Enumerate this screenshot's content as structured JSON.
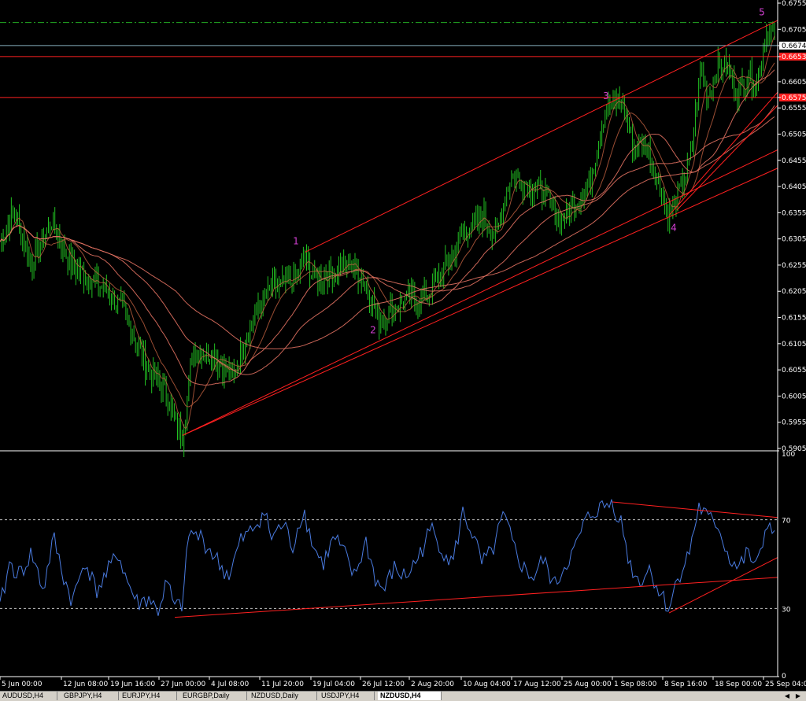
{
  "chart_data": [
    {
      "type": "candlestick",
      "symbol": "NZDUSD",
      "timeframe": "H4",
      "price_ylim": [
        0.5905,
        0.6755
      ],
      "price_ticks": [
        "0.6755",
        "0.6705",
        "0.6674",
        "0.6653",
        "0.6605",
        "0.6575",
        "0.6555",
        "0.6505",
        "0.6455",
        "0.6405",
        "0.6355",
        "0.6305",
        "0.6255",
        "0.6205",
        "0.6155",
        "0.6105",
        "0.6055",
        "0.6005",
        "0.5955",
        "0.5905"
      ],
      "current_price": "0.6674",
      "highlighted_levels": [
        "0.6653",
        "0.6575"
      ],
      "horizontal_levels": [
        {
          "price": 0.6718,
          "style": "dash-dot",
          "color": "#22aa22"
        },
        {
          "price": 0.6674,
          "style": "solid",
          "color": "#88b0c0"
        },
        {
          "price": 0.6653,
          "style": "solid",
          "color": "#ff2020"
        },
        {
          "price": 0.6575,
          "style": "solid",
          "color": "#ff2020"
        }
      ],
      "wave_labels": [
        "1",
        "2",
        "3",
        "4",
        "5"
      ],
      "x_ticks": [
        "5 Jun 00:00",
        "12 Jun 08:00",
        "19 Jun 16:00",
        "27 Jun 00:00",
        "4 Jul 08:00",
        "11 Jul 20:00",
        "19 Jul 04:00",
        "26 Jul 12:00",
        "2 Aug 20:00",
        "10 Aug 04:00",
        "17 Aug 12:00",
        "25 Aug 00:00",
        "1 Sep 08:00",
        "8 Sep 16:00",
        "18 Sep 00:00",
        "25 Sep 04:00"
      ],
      "anchor_closes": [
        [
          0,
          0.63
        ],
        [
          18,
          0.636
        ],
        [
          40,
          0.6255
        ],
        [
          65,
          0.634
        ],
        [
          90,
          0.6255
        ],
        [
          115,
          0.623
        ],
        [
          140,
          0.62
        ],
        [
          160,
          0.616
        ],
        [
          185,
          0.606
        ],
        [
          210,
          0.602
        ],
        [
          225,
          0.5945
        ],
        [
          232,
          0.593
        ],
        [
          245,
          0.6095
        ],
        [
          270,
          0.6085
        ],
        [
          295,
          0.604
        ],
        [
          320,
          0.615
        ],
        [
          345,
          0.621
        ],
        [
          370,
          0.622
        ],
        [
          388,
          0.627
        ],
        [
          400,
          0.6225
        ],
        [
          420,
          0.624
        ],
        [
          445,
          0.626
        ],
        [
          465,
          0.622
        ],
        [
          482,
          0.615
        ],
        [
          500,
          0.6175
        ],
        [
          520,
          0.619
        ],
        [
          540,
          0.6195
        ],
        [
          565,
          0.625
        ],
        [
          590,
          0.632
        ],
        [
          615,
          0.6345
        ],
        [
          630,
          0.6305
        ],
        [
          648,
          0.6425
        ],
        [
          670,
          0.641
        ],
        [
          690,
          0.6395
        ],
        [
          712,
          0.634
        ],
        [
          730,
          0.637
        ],
        [
          750,
          0.642
        ],
        [
          770,
          0.656
        ],
        [
          790,
          0.6565
        ],
        [
          805,
          0.648
        ],
        [
          820,
          0.649
        ],
        [
          835,
          0.642
        ],
        [
          850,
          0.635
        ],
        [
          865,
          0.64
        ],
        [
          878,
          0.646
        ],
        [
          890,
          0.663
        ],
        [
          900,
          0.658
        ],
        [
          912,
          0.664
        ],
        [
          925,
          0.663
        ],
        [
          938,
          0.6585
        ],
        [
          950,
          0.662
        ],
        [
          962,
          0.66
        ],
        [
          972,
          0.67
        ],
        [
          985,
          0.669
        ]
      ],
      "rsi_ylim": [
        0,
        100
      ],
      "rsi_ticks": [
        "100",
        "70",
        "30",
        "0"
      ],
      "rsi_levels": [
        70,
        30
      ],
      "rsi_anchors": [
        [
          0,
          30
        ],
        [
          12,
          50
        ],
        [
          25,
          45
        ],
        [
          40,
          55
        ],
        [
          55,
          38
        ],
        [
          68,
          62
        ],
        [
          80,
          45
        ],
        [
          92,
          33
        ],
        [
          108,
          52
        ],
        [
          122,
          38
        ],
        [
          135,
          45
        ],
        [
          150,
          55
        ],
        [
          162,
          42
        ],
        [
          175,
          32
        ],
        [
          190,
          35
        ],
        [
          200,
          28
        ],
        [
          212,
          42
        ],
        [
          222,
          30
        ],
        [
          232,
          32
        ],
        [
          240,
          64
        ],
        [
          255,
          62
        ],
        [
          270,
          55
        ],
        [
          282,
          48
        ],
        [
          292,
          45
        ],
        [
          305,
          60
        ],
        [
          320,
          65
        ],
        [
          335,
          74
        ],
        [
          345,
          62
        ],
        [
          360,
          68
        ],
        [
          372,
          58
        ],
        [
          385,
          75
        ],
        [
          398,
          58
        ],
        [
          410,
          50
        ],
        [
          425,
          62
        ],
        [
          438,
          54
        ],
        [
          450,
          44
        ],
        [
          465,
          60
        ],
        [
          478,
          42
        ],
        [
          488,
          38
        ],
        [
          500,
          48
        ],
        [
          515,
          44
        ],
        [
          530,
          52
        ],
        [
          548,
          66
        ],
        [
          560,
          58
        ],
        [
          575,
          50
        ],
        [
          588,
          73
        ],
        [
          600,
          64
        ],
        [
          612,
          50
        ],
        [
          625,
          55
        ],
        [
          640,
          72
        ],
        [
          652,
          58
        ],
        [
          665,
          48
        ],
        [
          678,
          44
        ],
        [
          690,
          52
        ],
        [
          705,
          40
        ],
        [
          718,
          50
        ],
        [
          730,
          56
        ],
        [
          742,
          68
        ],
        [
          755,
          74
        ],
        [
          768,
          76
        ],
        [
          778,
          78
        ],
        [
          790,
          68
        ],
        [
          800,
          50
        ],
        [
          812,
          42
        ],
        [
          825,
          48
        ],
        [
          840,
          36
        ],
        [
          850,
          30
        ],
        [
          862,
          45
        ],
        [
          875,
          54
        ],
        [
          888,
          76
        ],
        [
          900,
          70
        ],
        [
          912,
          68
        ],
        [
          925,
          54
        ],
        [
          938,
          48
        ],
        [
          950,
          55
        ],
        [
          962,
          48
        ],
        [
          975,
          70
        ],
        [
          985,
          60
        ]
      ]
    }
  ],
  "tabs": [
    {
      "label": "AUDUSD,H4"
    },
    {
      "label": "GBPJPY,H4"
    },
    {
      "label": "EURJPY,H4"
    },
    {
      "label": "EURGBP,Daily"
    },
    {
      "label": "NZDUSD,Daily"
    },
    {
      "label": "USDJPY,H4"
    },
    {
      "label": "NZDUSD,H4"
    }
  ],
  "active_tab": "NZDUSD,H4",
  "colors": {
    "background": "#000000",
    "bull_candle": "#22c022",
    "ma_line": "#e07060",
    "trend_line": "#ff2020",
    "rsi_line": "#4a7be0",
    "wave_label": "#d040d0",
    "axis_text": "#ffffff"
  },
  "icons": {
    "scroll_left": "triangle-left-icon",
    "scroll_right": "triangle-right-icon"
  }
}
